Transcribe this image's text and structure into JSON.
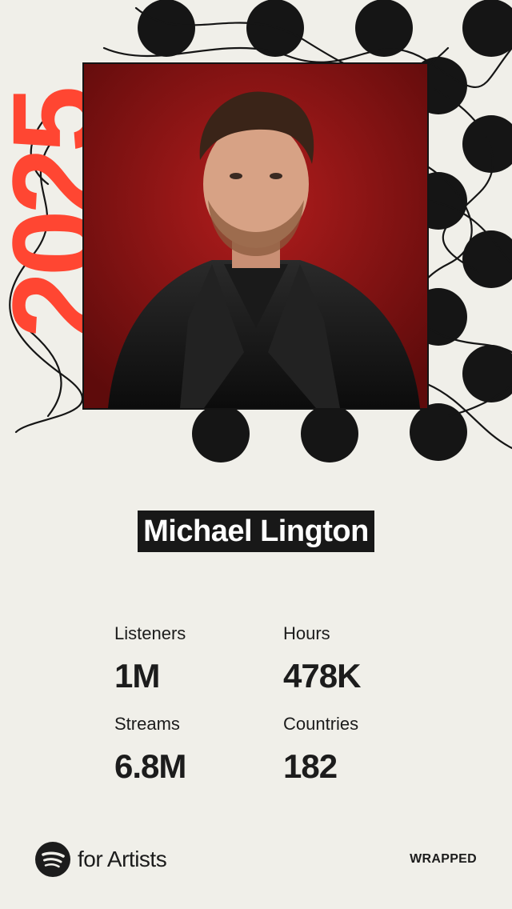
{
  "year": "2025",
  "artist": {
    "name": "Michael Lington"
  },
  "stats": [
    {
      "label": "Listeners",
      "value": "1M"
    },
    {
      "label": "Hours",
      "value": "478K"
    },
    {
      "label": "Streams",
      "value": "6.8M"
    },
    {
      "label": "Countries",
      "value": "182"
    }
  ],
  "footer": {
    "brand_icon": "spotify-icon",
    "brand_text": "for Artists",
    "badge": "WRAPPED"
  },
  "colors": {
    "background": "#f0efe9",
    "accent": "#ff4632",
    "ink": "#181818",
    "photo_backdrop": "#8a1414"
  }
}
